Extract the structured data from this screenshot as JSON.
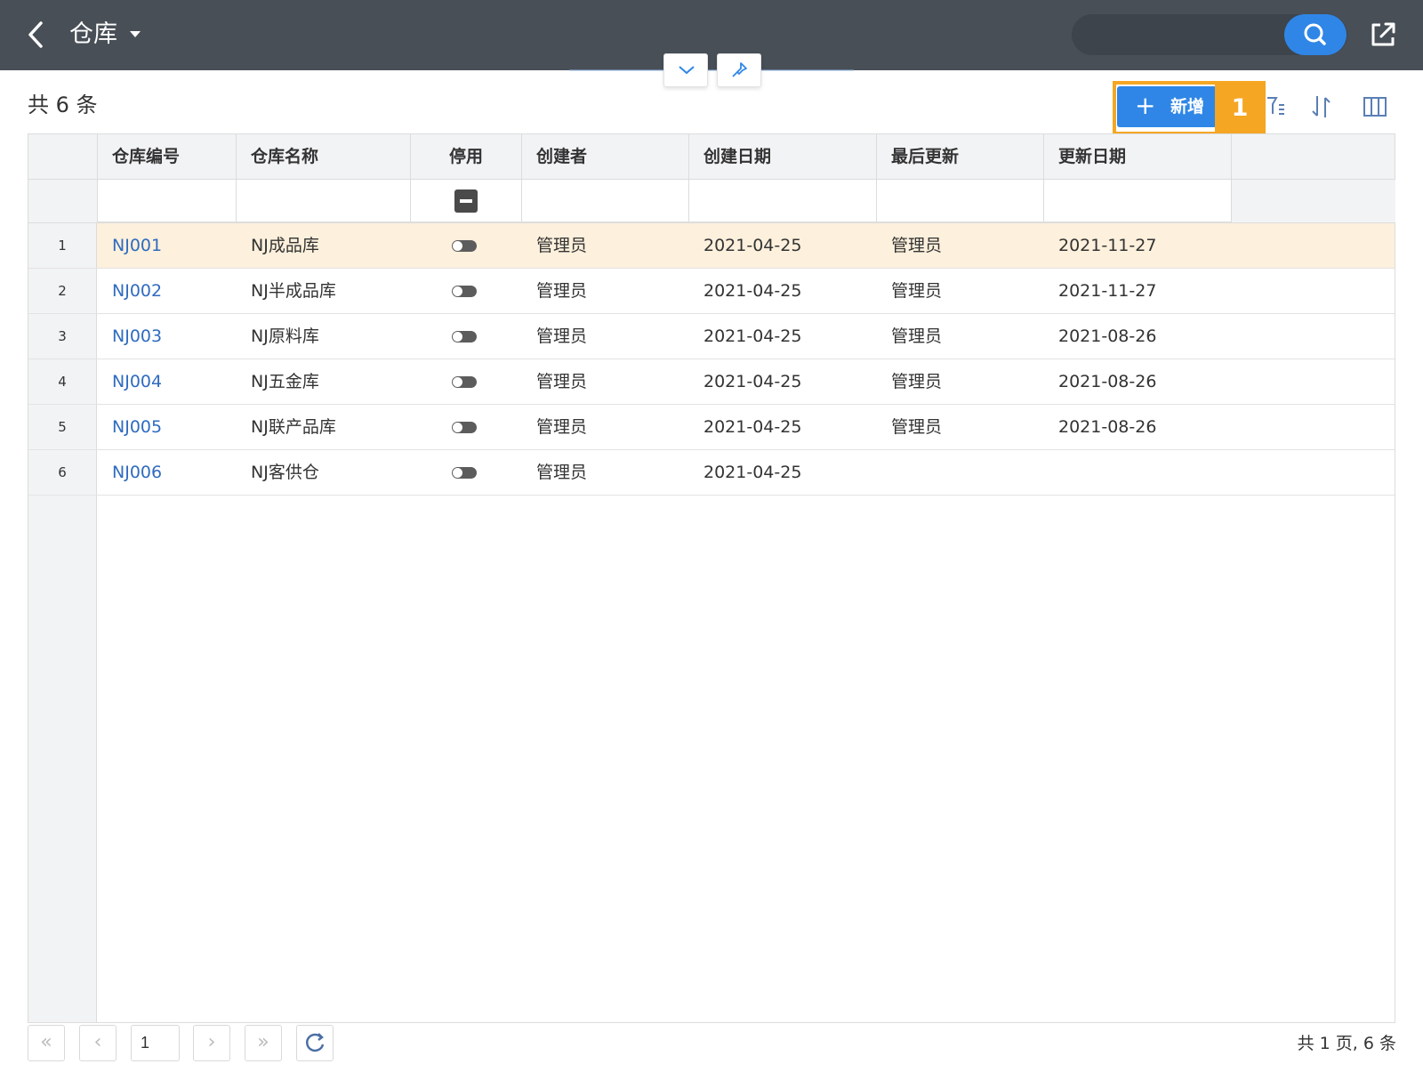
{
  "header": {
    "title": "仓库"
  },
  "toolbar": {
    "record_count": "共 6 条",
    "add_label": "新增",
    "add_plus": "+",
    "step_badge": "1"
  },
  "table": {
    "columns": [
      "仓库编号",
      "仓库名称",
      "停用",
      "创建者",
      "创建日期",
      "最后更新",
      "更新日期"
    ],
    "rows": [
      {
        "n": "1",
        "code": "NJ001",
        "name": "NJ成品库",
        "creator": "管理员",
        "created": "2021-04-25",
        "updater": "管理员",
        "updated": "2021-11-27"
      },
      {
        "n": "2",
        "code": "NJ002",
        "name": "NJ半成品库",
        "creator": "管理员",
        "created": "2021-04-25",
        "updater": "管理员",
        "updated": "2021-11-27"
      },
      {
        "n": "3",
        "code": "NJ003",
        "name": "NJ原料库",
        "creator": "管理员",
        "created": "2021-04-25",
        "updater": "管理员",
        "updated": "2021-08-26"
      },
      {
        "n": "4",
        "code": "NJ004",
        "name": "NJ五金库",
        "creator": "管理员",
        "created": "2021-04-25",
        "updater": "管理员",
        "updated": "2021-08-26"
      },
      {
        "n": "5",
        "code": "NJ005",
        "name": "NJ联产品库",
        "creator": "管理员",
        "created": "2021-04-25",
        "updater": "管理员",
        "updated": "2021-08-26"
      },
      {
        "n": "6",
        "code": "NJ006",
        "name": "NJ客供仓",
        "creator": "管理员",
        "created": "2021-04-25",
        "updater": "",
        "updated": ""
      }
    ]
  },
  "pagination": {
    "first": "«",
    "prev": "‹",
    "current_page": "1",
    "next": "›",
    "last": "»",
    "summary": "共 1 页, 6 条"
  },
  "colors": {
    "topbar": "#484f57",
    "accent": "#2f86e6",
    "highlight": "#f5a623",
    "selected_row": "#fdf0dc"
  },
  "icons": [
    "back-icon",
    "caret-down-icon",
    "search-icon",
    "share-icon",
    "chevron-down-icon",
    "pin-icon",
    "filter-list-icon",
    "sort-icon",
    "columns-icon",
    "refresh-icon"
  ]
}
